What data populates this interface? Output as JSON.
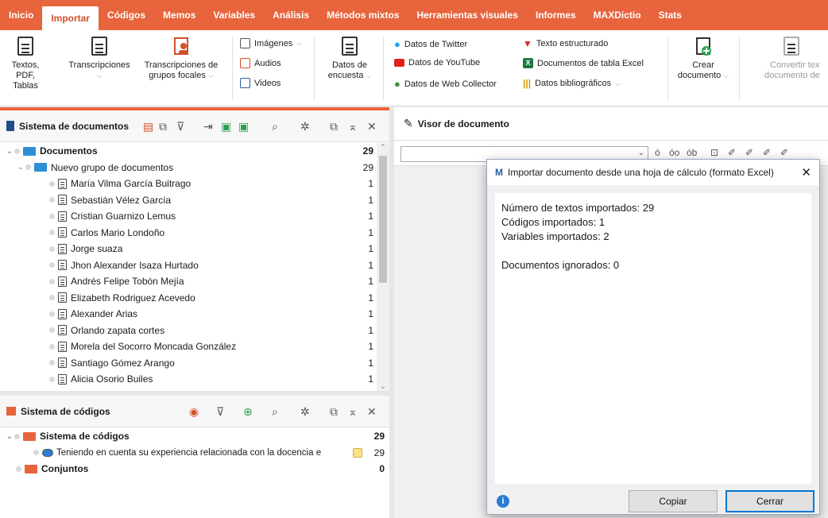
{
  "menu": {
    "tabs": [
      "Inicio",
      "Importar",
      "Códigos",
      "Memos",
      "Variables",
      "Análisis",
      "Métodos mixtos",
      "Herramientas visuales",
      "Informes",
      "MAXDictio",
      "Stats"
    ],
    "active": "Importar"
  },
  "ribbon": {
    "textos_label": "Textos, PDF,",
    "textos_label2": "Tablas",
    "transcripciones_label": "Transcripciones",
    "grupos_label": "Transcripciones de",
    "grupos_label2": "grupos focales",
    "imagenes_label": "Imágenes",
    "audios_label": "Audios",
    "videos_label": "Videos",
    "encuesta_label": "Datos de",
    "encuesta_label2": "encuesta",
    "twitter_label": "Datos de Twitter",
    "youtube_label": "Datos de YouTube",
    "webcollector_label": "Datos de Web Collector",
    "estructurado_label": "Texto estructurado",
    "excel_label": "Documentos de tabla Excel",
    "biblio_label": "Datos bibliográficos",
    "crear_label": "Crear",
    "crear_label2": "documento",
    "convertir_label": "Convertir tex",
    "convertir_label2": "documento de"
  },
  "documents_panel": {
    "title": "Sistema de documentos",
    "root_label": "Documentos",
    "root_count": "29",
    "group_label": "Nuevo grupo de documentos",
    "group_count": "29",
    "items": [
      {
        "name": "María Vilma García Buitrago",
        "count": "1"
      },
      {
        "name": "Sebastián Vélez García",
        "count": "1"
      },
      {
        "name": "Cristian Guarnizo Lemus",
        "count": "1"
      },
      {
        "name": "Carlos Mario Londoño",
        "count": "1"
      },
      {
        "name": "Jorge suaza",
        "count": "1"
      },
      {
        "name": "Jhon Alexander Isaza Hurtado",
        "count": "1"
      },
      {
        "name": "Andrés Felipe Tobón Mejía",
        "count": "1"
      },
      {
        "name": "Elizabeth Rodriguez Acevedo",
        "count": "1"
      },
      {
        "name": "Alexander Arias",
        "count": "1"
      },
      {
        "name": "Orlando zapata cortes",
        "count": "1"
      },
      {
        "name": "Morela del Socorro Moncada González",
        "count": "1"
      },
      {
        "name": "Santiago Gómez Arango",
        "count": "1"
      },
      {
        "name": "Alicia Osorio Builes",
        "count": "1"
      }
    ]
  },
  "codes_panel": {
    "title": "Sistema de códigos",
    "root_label": "Sistema de códigos",
    "root_count": "29",
    "code_label": "Teniendo en cuenta su experiencia relacionada con la docencia e",
    "code_count": "29",
    "sets_label": "Conjuntos",
    "sets_count": "0"
  },
  "viewer": {
    "title": "Visor de documento"
  },
  "dialog": {
    "title": "Importar documento desde una hoja de cálculo (formato Excel)",
    "line1": "Número de textos importados: 29",
    "line2": "Códigos importados: 1",
    "line3": "Variables importados: 2",
    "line4": "Documentos ignorados: 0",
    "copy_button": "Copiar",
    "close_button": "Cerrar"
  },
  "colors": {
    "accent": "#e8643c",
    "folder_blue": "#2d8fd6",
    "info_blue": "#2b7cd3",
    "focus_blue": "#0078d7"
  }
}
